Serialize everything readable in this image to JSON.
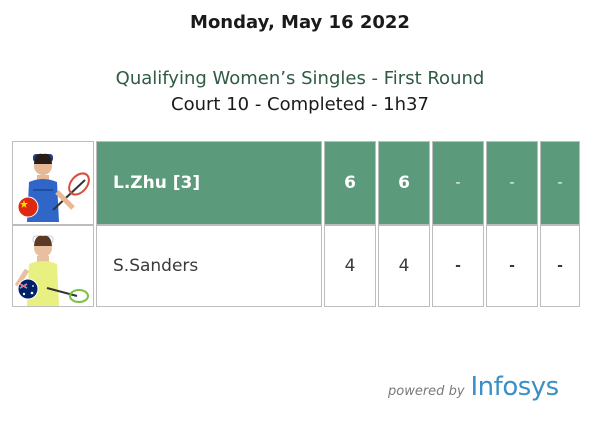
{
  "header": {
    "date": "Monday, May 16 2022",
    "event": "Qualifying Women’s Singles - First Round",
    "court_status": "Court 10 - Completed - 1h37"
  },
  "players": [
    {
      "name": "L.Zhu [3]",
      "flag_icon": "china-flag-icon",
      "winner": true,
      "sets": [
        "6",
        "6",
        "-",
        "-",
        "-"
      ]
    },
    {
      "name": "S.Sanders",
      "flag_icon": "australia-flag-icon",
      "winner": false,
      "sets": [
        "4",
        "4",
        "-",
        "-",
        "-"
      ]
    }
  ],
  "footer": {
    "powered_by": "powered by",
    "brand": "Infosys"
  },
  "colors": {
    "winner_row": "#5b9a7b",
    "event_text": "#2f5a43",
    "brand": "#3a8fc7"
  }
}
